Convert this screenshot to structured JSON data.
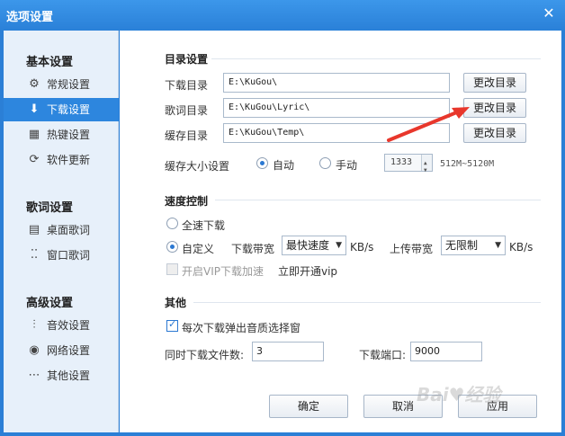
{
  "window": {
    "title": "选项设置"
  },
  "sidebar": {
    "groups": [
      {
        "title": "基本设置",
        "items": [
          {
            "label": "常规设置",
            "icon": "gear-icon",
            "glyph": "⚙"
          },
          {
            "label": "下载设置",
            "icon": "download-icon",
            "glyph": "⬇",
            "active": true
          },
          {
            "label": "热键设置",
            "icon": "keyboard-icon",
            "glyph": "▦"
          },
          {
            "label": "软件更新",
            "icon": "update-icon",
            "glyph": "⟳"
          }
        ]
      },
      {
        "title": "歌词设置",
        "items": [
          {
            "label": "桌面歌词",
            "icon": "desktop-lyric-icon",
            "glyph": "▤"
          },
          {
            "label": "窗口歌词",
            "icon": "window-lyric-icon",
            "glyph": "⁚⁚"
          }
        ]
      },
      {
        "title": "高级设置",
        "items": [
          {
            "label": "音效设置",
            "icon": "equalizer-icon",
            "glyph": "⫶"
          },
          {
            "label": "网络设置",
            "icon": "network-icon",
            "glyph": "◉"
          },
          {
            "label": "其他设置",
            "icon": "more-icon",
            "glyph": "⋯"
          }
        ]
      }
    ]
  },
  "directory": {
    "title": "目录设置",
    "rows": [
      {
        "label": "下载目录",
        "value": "E:\\KuGou\\",
        "button": "更改目录"
      },
      {
        "label": "歌词目录",
        "value": "E:\\KuGou\\Lyric\\",
        "button": "更改目录"
      },
      {
        "label": "缓存目录",
        "value": "E:\\KuGou\\Temp\\",
        "button": "更改目录"
      }
    ],
    "cache_size": {
      "label": "缓存大小设置",
      "auto": "自动",
      "manual": "手动",
      "value": "1333",
      "range": "512M~5120M",
      "selected": "auto"
    }
  },
  "speed": {
    "title": "速度控制",
    "full_speed": "全速下载",
    "custom": "自定义",
    "selected": "custom",
    "download_label": "下载带宽",
    "download_value": "最快速度",
    "download_unit": "KB/s",
    "upload_label": "上传带宽",
    "upload_value": "无限制",
    "upload_unit": "KB/s",
    "vip_label": "开启VIP下载加速",
    "vip_link": "立即开通vip"
  },
  "other": {
    "title": "其他",
    "quality_popup_label": "每次下载弹出音质选择窗",
    "quality_popup_checked": true,
    "concurrent_label": "同时下载文件数:",
    "concurrent_value": "3",
    "port_label": "下载端口:",
    "port_value": "9000"
  },
  "footer": {
    "ok": "确定",
    "cancel": "取消",
    "apply": "应用"
  },
  "colors": {
    "titlebar": "#2a80d8",
    "sidebar_bg": "#e7f0fa",
    "active_item": "#2d86de",
    "annotation_arrow": "#e8372c"
  }
}
